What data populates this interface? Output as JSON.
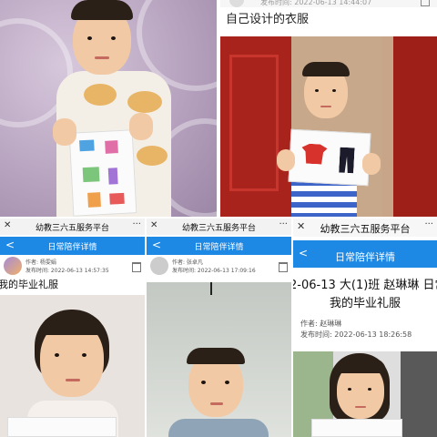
{
  "post_top": {
    "meta_text": "发布时间: 2022-06-13 14:44:07",
    "title": "自己设计的衣服"
  },
  "apps": [
    {
      "topbar_title": "幼教三六五服务平台",
      "close_glyph": "✕",
      "menu_glyph": "···",
      "nav_title": "日常陪伴详情",
      "back_glyph": "<",
      "author": "作者: 杨雯娟",
      "published": "发布时间: 2022-06-13 14:57:35",
      "post_title": "我的毕业礼服"
    },
    {
      "topbar_title": "幼教三六五服务平台",
      "close_glyph": "✕",
      "menu_glyph": "···",
      "nav_title": "日常陪伴详情",
      "back_glyph": "<",
      "author": "作者: 张卓凡",
      "published": "发布时间: 2022-06-13 17:09:16",
      "post_title": ""
    },
    {
      "topbar_title": "幼教三六五服务平台",
      "close_glyph": "✕",
      "menu_glyph": "···",
      "nav_title": "日常陪伴详情",
      "back_glyph": "<",
      "header_line": "2-06-13 大(1)班 赵琳琳 日常",
      "post_title": "我的毕业礼服",
      "author": "作者: 赵琳琳",
      "published": "发布时间: 2022-06-13 18:26:58"
    }
  ],
  "colors": {
    "nav_blue": "#1e88e5",
    "topbar_gray": "#f2f2f2"
  }
}
